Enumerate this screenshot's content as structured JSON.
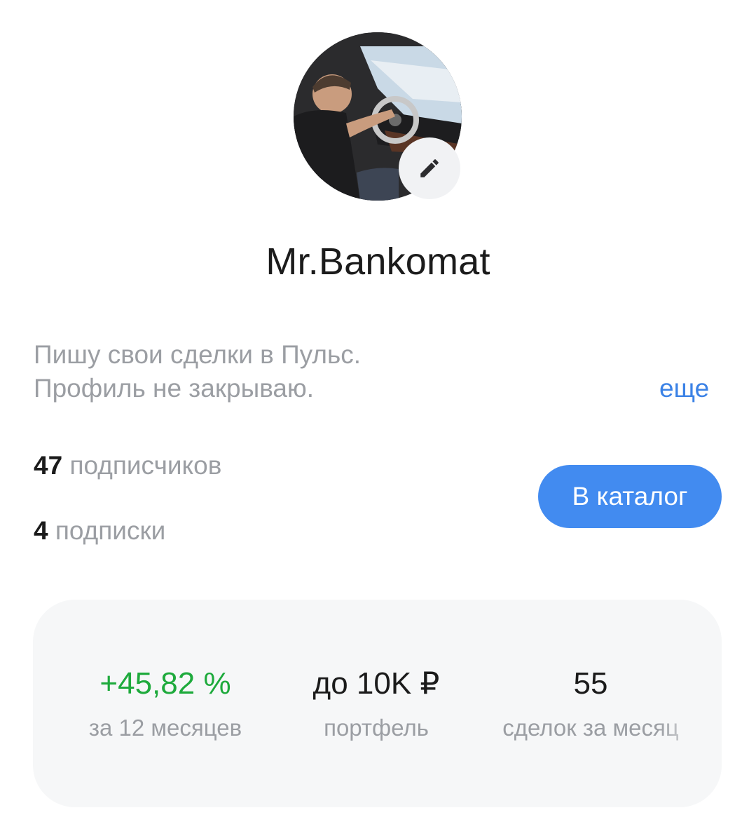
{
  "profile": {
    "username": "Mr.Bankomat",
    "bio_lines": [
      "Пишу свои сделки в Пульс.",
      "Профиль не закрываю."
    ],
    "more_label": "еще",
    "followers": {
      "count": "47",
      "label": "подписчиков"
    },
    "following": {
      "count": "4",
      "label": "подписки"
    },
    "catalog_button": "В каталог"
  },
  "stats": [
    {
      "value": "+45,82 %",
      "caption": "за 12 месяцев",
      "color": "#1eaa3c"
    },
    {
      "value": "до 10K ₽",
      "caption": "портфель"
    },
    {
      "value": "55",
      "caption": "сделок за месяц"
    }
  ],
  "icons": {
    "avatar": "user-photo",
    "edit": "pencil-icon"
  },
  "colors": {
    "accent": "#428bf0",
    "link": "#3b82e6",
    "positive": "#1eaa3c",
    "muted": "#9b9ea3"
  }
}
